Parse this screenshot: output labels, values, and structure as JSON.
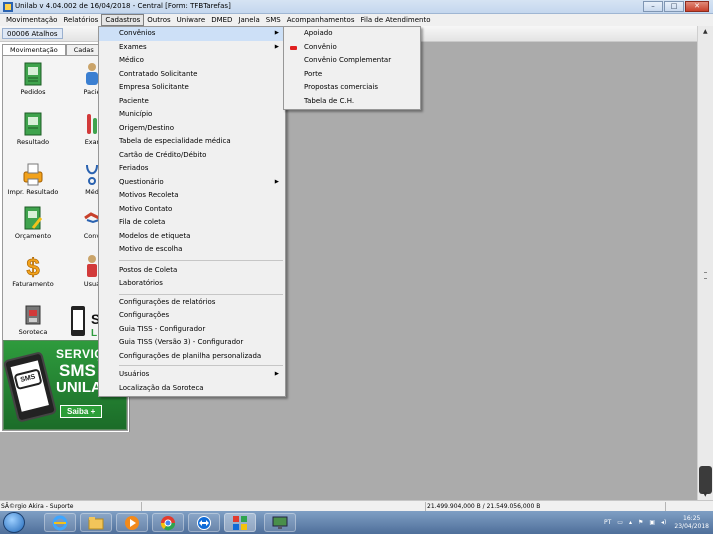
{
  "window": {
    "title": "Unilab v 4.04.002 de 16/04/2018 - Central  [Form: TFBTarefas]",
    "buttons": {
      "minimize": "–",
      "maximize": "□",
      "close": "✕"
    }
  },
  "menubar": {
    "items": [
      "Movimentação",
      "Relatórios",
      "Cadastros",
      "Outros",
      "Uniware",
      "DMED",
      "Janela",
      "SMS",
      "Acompanhamentos",
      "Fila de Atendimento"
    ]
  },
  "toolbar": {
    "atalhos_label": "00006 Atalhos"
  },
  "shortcuts": {
    "tabs": [
      "Movimentação",
      "Cadas"
    ],
    "items": [
      "Pedidos",
      "Pacie",
      "Resultado",
      "Exar",
      "Impr. Resultado",
      "Méd",
      "Orçamento",
      "Conv",
      "Faturamento",
      "Usuá",
      "Soroteca"
    ],
    "soroteca_logo_text": "S",
    "soroteca_logo_sub": "L"
  },
  "banner": {
    "line1": "SERVIÇ",
    "line2": "SMS",
    "line3": "UNILA",
    "phone_text": "SMS",
    "cta": "Saiba +"
  },
  "cadastros_menu": {
    "items": [
      {
        "label": "Convênios",
        "submenu": true
      },
      {
        "label": "Exames",
        "submenu": true
      },
      {
        "label": "Médico"
      },
      {
        "label": "Contratado Solicitante"
      },
      {
        "label": "Empresa Solicitante"
      },
      {
        "label": "Paciente"
      },
      {
        "label": "Município"
      },
      {
        "label": "Origem/Destino"
      },
      {
        "label": "Tabela de especialidade médica"
      },
      {
        "label": "Cartão de Crédito/Débito"
      },
      {
        "label": "Feriados"
      },
      {
        "label": "Questionário",
        "submenu": true
      },
      {
        "label": "Motivos Recoleta"
      },
      {
        "label": "Motivo Contato"
      },
      {
        "label": "Fila de coleta"
      },
      {
        "label": "Modelos de etiqueta"
      },
      {
        "label": "Motivo de escolha"
      },
      {
        "label": "Postos de Coleta"
      },
      {
        "label": "Laboratórios"
      },
      {
        "label": "Configurações de relatórios"
      },
      {
        "label": "Configurações"
      },
      {
        "label": "Guia TISS - Configurador"
      },
      {
        "label": "Guia TISS (Versão 3) - Configurador"
      },
      {
        "label": "Configurações de planilha personalizada"
      },
      {
        "label": "Usuários",
        "submenu": true
      },
      {
        "label": "Localização da Soroteca"
      }
    ]
  },
  "convenios_menu": {
    "items": [
      "Apoiado",
      "Convênio",
      "Convênio Complementar",
      "Porte",
      "Propostas comerciais",
      "Tabela de C.H."
    ]
  },
  "statusbar": {
    "user": "SÃ©rgio Akira - Suporte",
    "memory": "21.499.904,000 B / 21.549.056,000 B"
  },
  "taskbar": {
    "lang": "PT",
    "time": "16:25",
    "date": "23/04/2018"
  },
  "colors": {
    "highlight": "#cde0f7",
    "banner_green": "#2e9b3d",
    "marker_red": "#e02020"
  }
}
